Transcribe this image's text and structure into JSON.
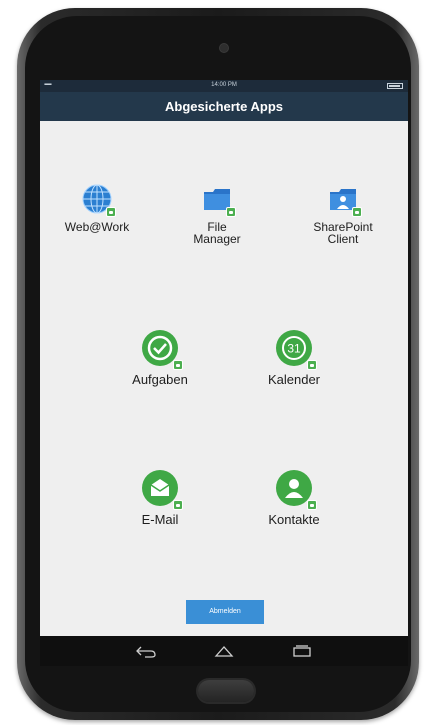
{
  "statusbar": {
    "signal": "▪▪▪▪▪▪",
    "time": "14:00 PM",
    "battery_icon": "battery-icon"
  },
  "titlebar": {
    "title": "Abgesicherte Apps"
  },
  "apps": [
    {
      "label": "Web@Work",
      "icon": "globe-icon"
    },
    {
      "label": "File\nManager",
      "icon": "folder-icon"
    },
    {
      "label": "SharePoint\nClient",
      "icon": "sharepoint-folder-icon"
    },
    {
      "label": "Aufgaben",
      "icon": "task-check-icon"
    },
    {
      "label": "Kalender",
      "icon": "calendar-icon"
    },
    {
      "label": "E-Mail",
      "icon": "email-icon"
    },
    {
      "label": "Kontakte",
      "icon": "contact-icon"
    }
  ],
  "badge_icon": "lock-badge-icon",
  "logout": {
    "label": "Abmelden"
  },
  "navbar": {
    "icons": [
      "back-icon",
      "home-icon",
      "recent-apps-icon"
    ]
  },
  "colors": {
    "titlebar": "#23384b",
    "statusbar": "#1d2b3a",
    "accent_green": "#4caf50",
    "button_blue": "#3a8fd6",
    "screen_bg": "#efefef"
  }
}
